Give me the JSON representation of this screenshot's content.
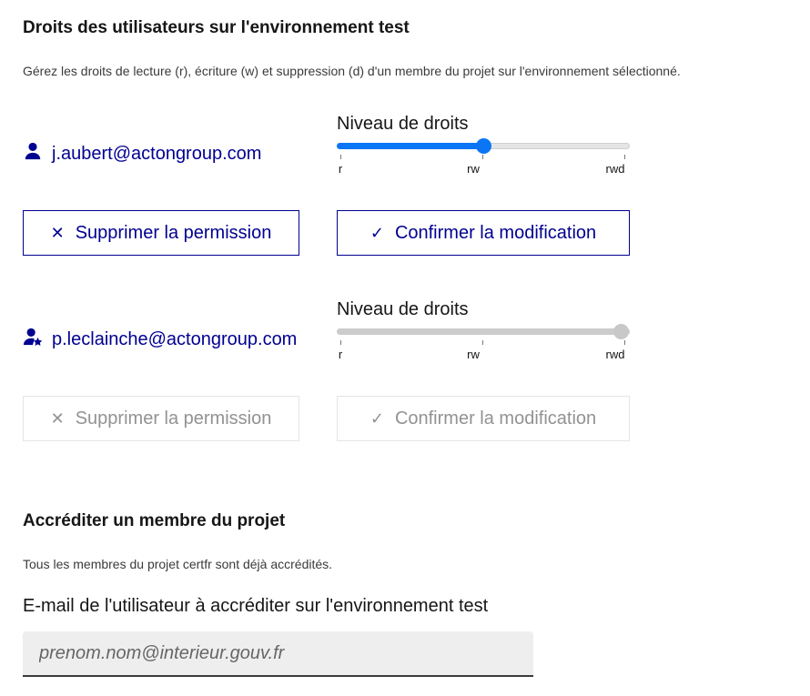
{
  "rights": {
    "title": "Droits des utilisateurs sur l'environnement test",
    "description": "Gérez les droits de lecture (r), écriture (w) et suppression (d) d'un membre du projet sur l'environnement sélectionné.",
    "slider_label": "Niveau de droits",
    "levels": [
      "r",
      "rw",
      "rwd"
    ],
    "users": [
      {
        "email": "j.aubert@actongroup.com",
        "icon": "user-icon",
        "level": "rw",
        "disabled": false,
        "remove_label": "Supprimer la permission",
        "confirm_label": "Confirmer la modification"
      },
      {
        "email": "p.leclainche@actongroup.com",
        "icon": "user-star-icon",
        "level": "rwd",
        "disabled": true,
        "remove_label": "Supprimer la permission",
        "confirm_label": "Confirmer la modification"
      }
    ]
  },
  "accredit": {
    "title": "Accréditer un membre du projet",
    "description": "Tous les membres du projet certfr sont déjà accrédités.",
    "email_label": "E-mail de l'utilisateur à accréditer sur l'environnement test",
    "email_placeholder": "prenom.nom@interieur.gouv.fr",
    "email_value": ""
  },
  "colors": {
    "primary": "#000091",
    "slider_active": "#0a76f6",
    "disabled": "#929292"
  }
}
